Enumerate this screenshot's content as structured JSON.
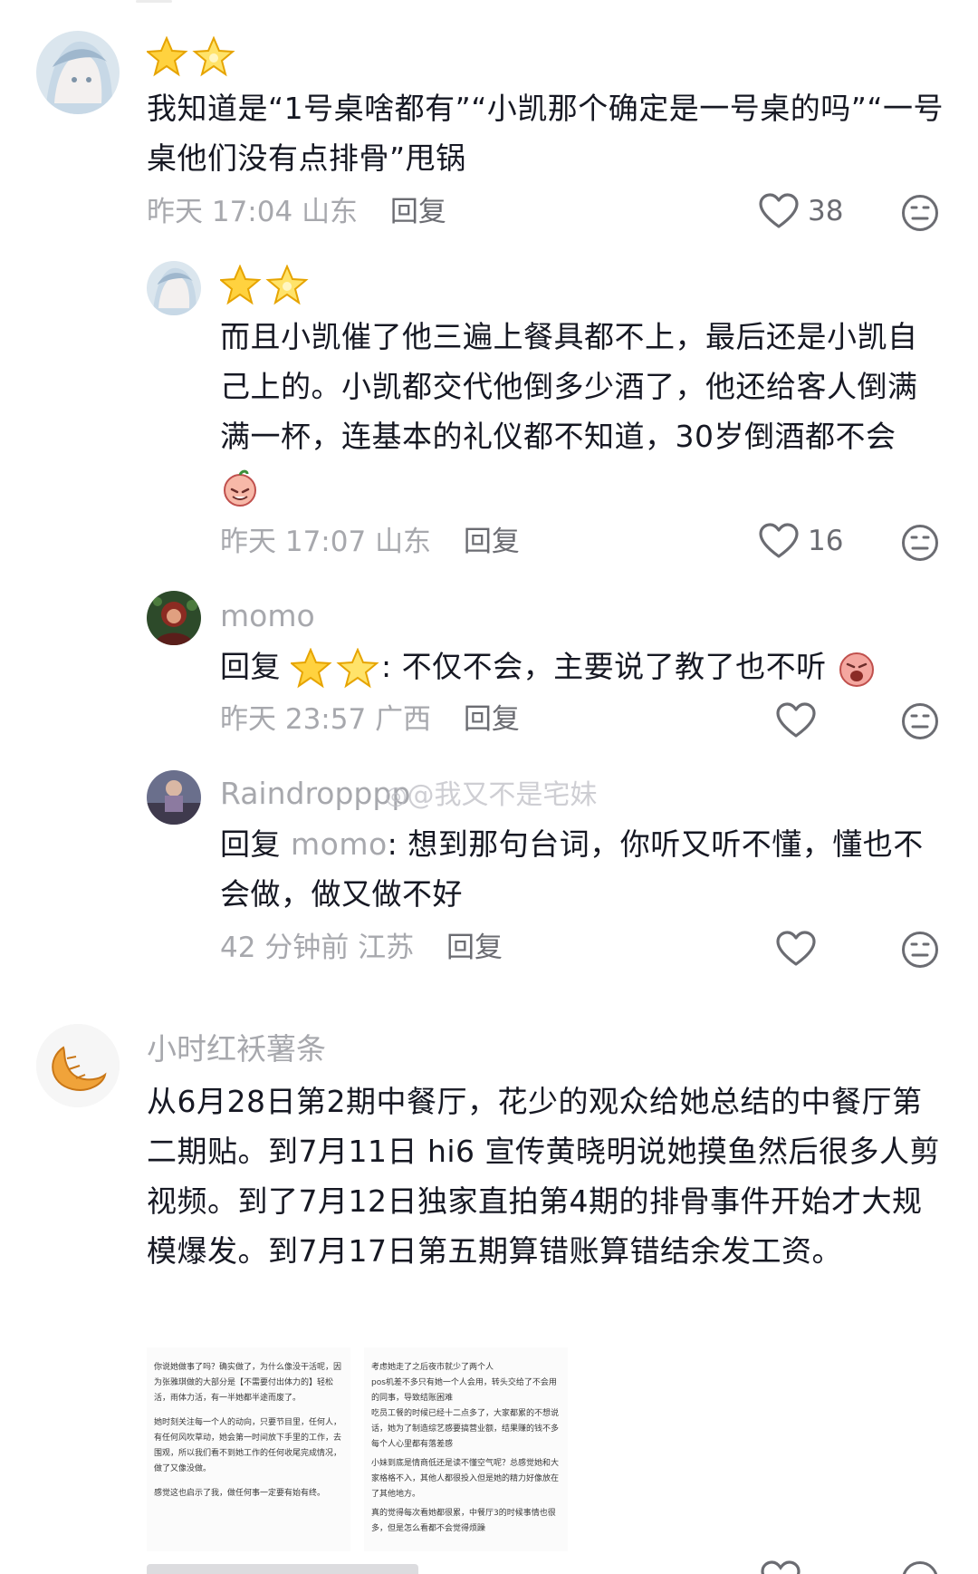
{
  "comments": [
    {
      "username": "",
      "text": "我知道是“1号桌啥都有”“小凯那个确定是一号桌的吗”“一号桌他们没有点排骨”甩锅",
      "time": "昨天 17:04",
      "location": "山东",
      "reply_label": "回复",
      "likes": "38"
    },
    {
      "username": "",
      "text": "而且小凯催了他三遍上餐具都不上，最后还是小凯自己上的。小凯都交代他倒多少酒了，他还给客人倒满满一杯，连基本的礼仪都不知道，30岁倒酒都不会",
      "time": "昨天 17:07",
      "location": "山东",
      "reply_label": "回复",
      "likes": "16"
    },
    {
      "username": "momo",
      "reply_prefix": "回复",
      "text": ": 不仅不会，主要说了教了也不听",
      "time": "昨天 23:57",
      "location": "广西",
      "reply_label": "回复",
      "likes": ""
    },
    {
      "username": "Raindropppp",
      "reply_prefix": "回复",
      "mention": "momo",
      "text": ": 想到那句台词，你听又听不懂，懂也不会做，做又做不好",
      "time": "42 分钟前",
      "location": "江苏",
      "reply_label": "回复",
      "likes": ""
    },
    {
      "username": "小时红袄薯条",
      "text": "从6月28日第2期中餐厅，花少的观众给她总结的中餐厅第二期贴。到7月11日 hi6 宣传黄晓明说她摸鱼然后很多人剪视频。到了7月12日独家直拍第4期的排骨事件开始才大规模爆发。到7月17日第五期算错账算错结余发工资。",
      "time": "",
      "location": "",
      "reply_label": "",
      "likes": ""
    }
  ],
  "watermark": "@我又不是宅妹",
  "attached_image_left": {
    "paragraphs": [
      "你说她做事了吗？确实做了，为什么像没干活呢，因为张雅琪做的大部分是【不需要付出体力的】轻松活，雨体力活，有一半她都半途而废了。",
      "她时刻关注每一个人的动向，只要节目里，任何人，有任何风吹草动，她会第一时间放下手里的工作，去围观，所以我们看不到她工作的任何收尾完成情况，做了又像没做。",
      "感觉这也启示了我，做任何事一定要有始有终。"
    ]
  },
  "attached_image_right": {
    "paragraphs": [
      "考虑她走了之后夜市就少了两个人",
      "pos机差不多只有她一个人会用，转头交给了不会用的同事，导致结账困难",
      "吃员工餐的时候已经十二点多了，大家都累的不想说话，她为了制造综艺感要搞营业额，结果赚的钱不多每个人心里都有落差感",
      "小妹到底是情商低还是读不懂空气呢？总感觉她和大家格格不入，其他人都很投入但是她的精力好像放在了其他地方。",
      "真的觉得每次看她都很累，中餐厅3的时候事情也很多，但是怎么看都不会觉得烦躁"
    ]
  },
  "icons": {
    "heart": "heart-outline-icon",
    "dislike": "neutral-face-icon",
    "stars": "star-emoji-icon"
  },
  "colors": {
    "text": "#161823",
    "secondary": "#a7a8ad",
    "reply": "#6b6c72"
  }
}
